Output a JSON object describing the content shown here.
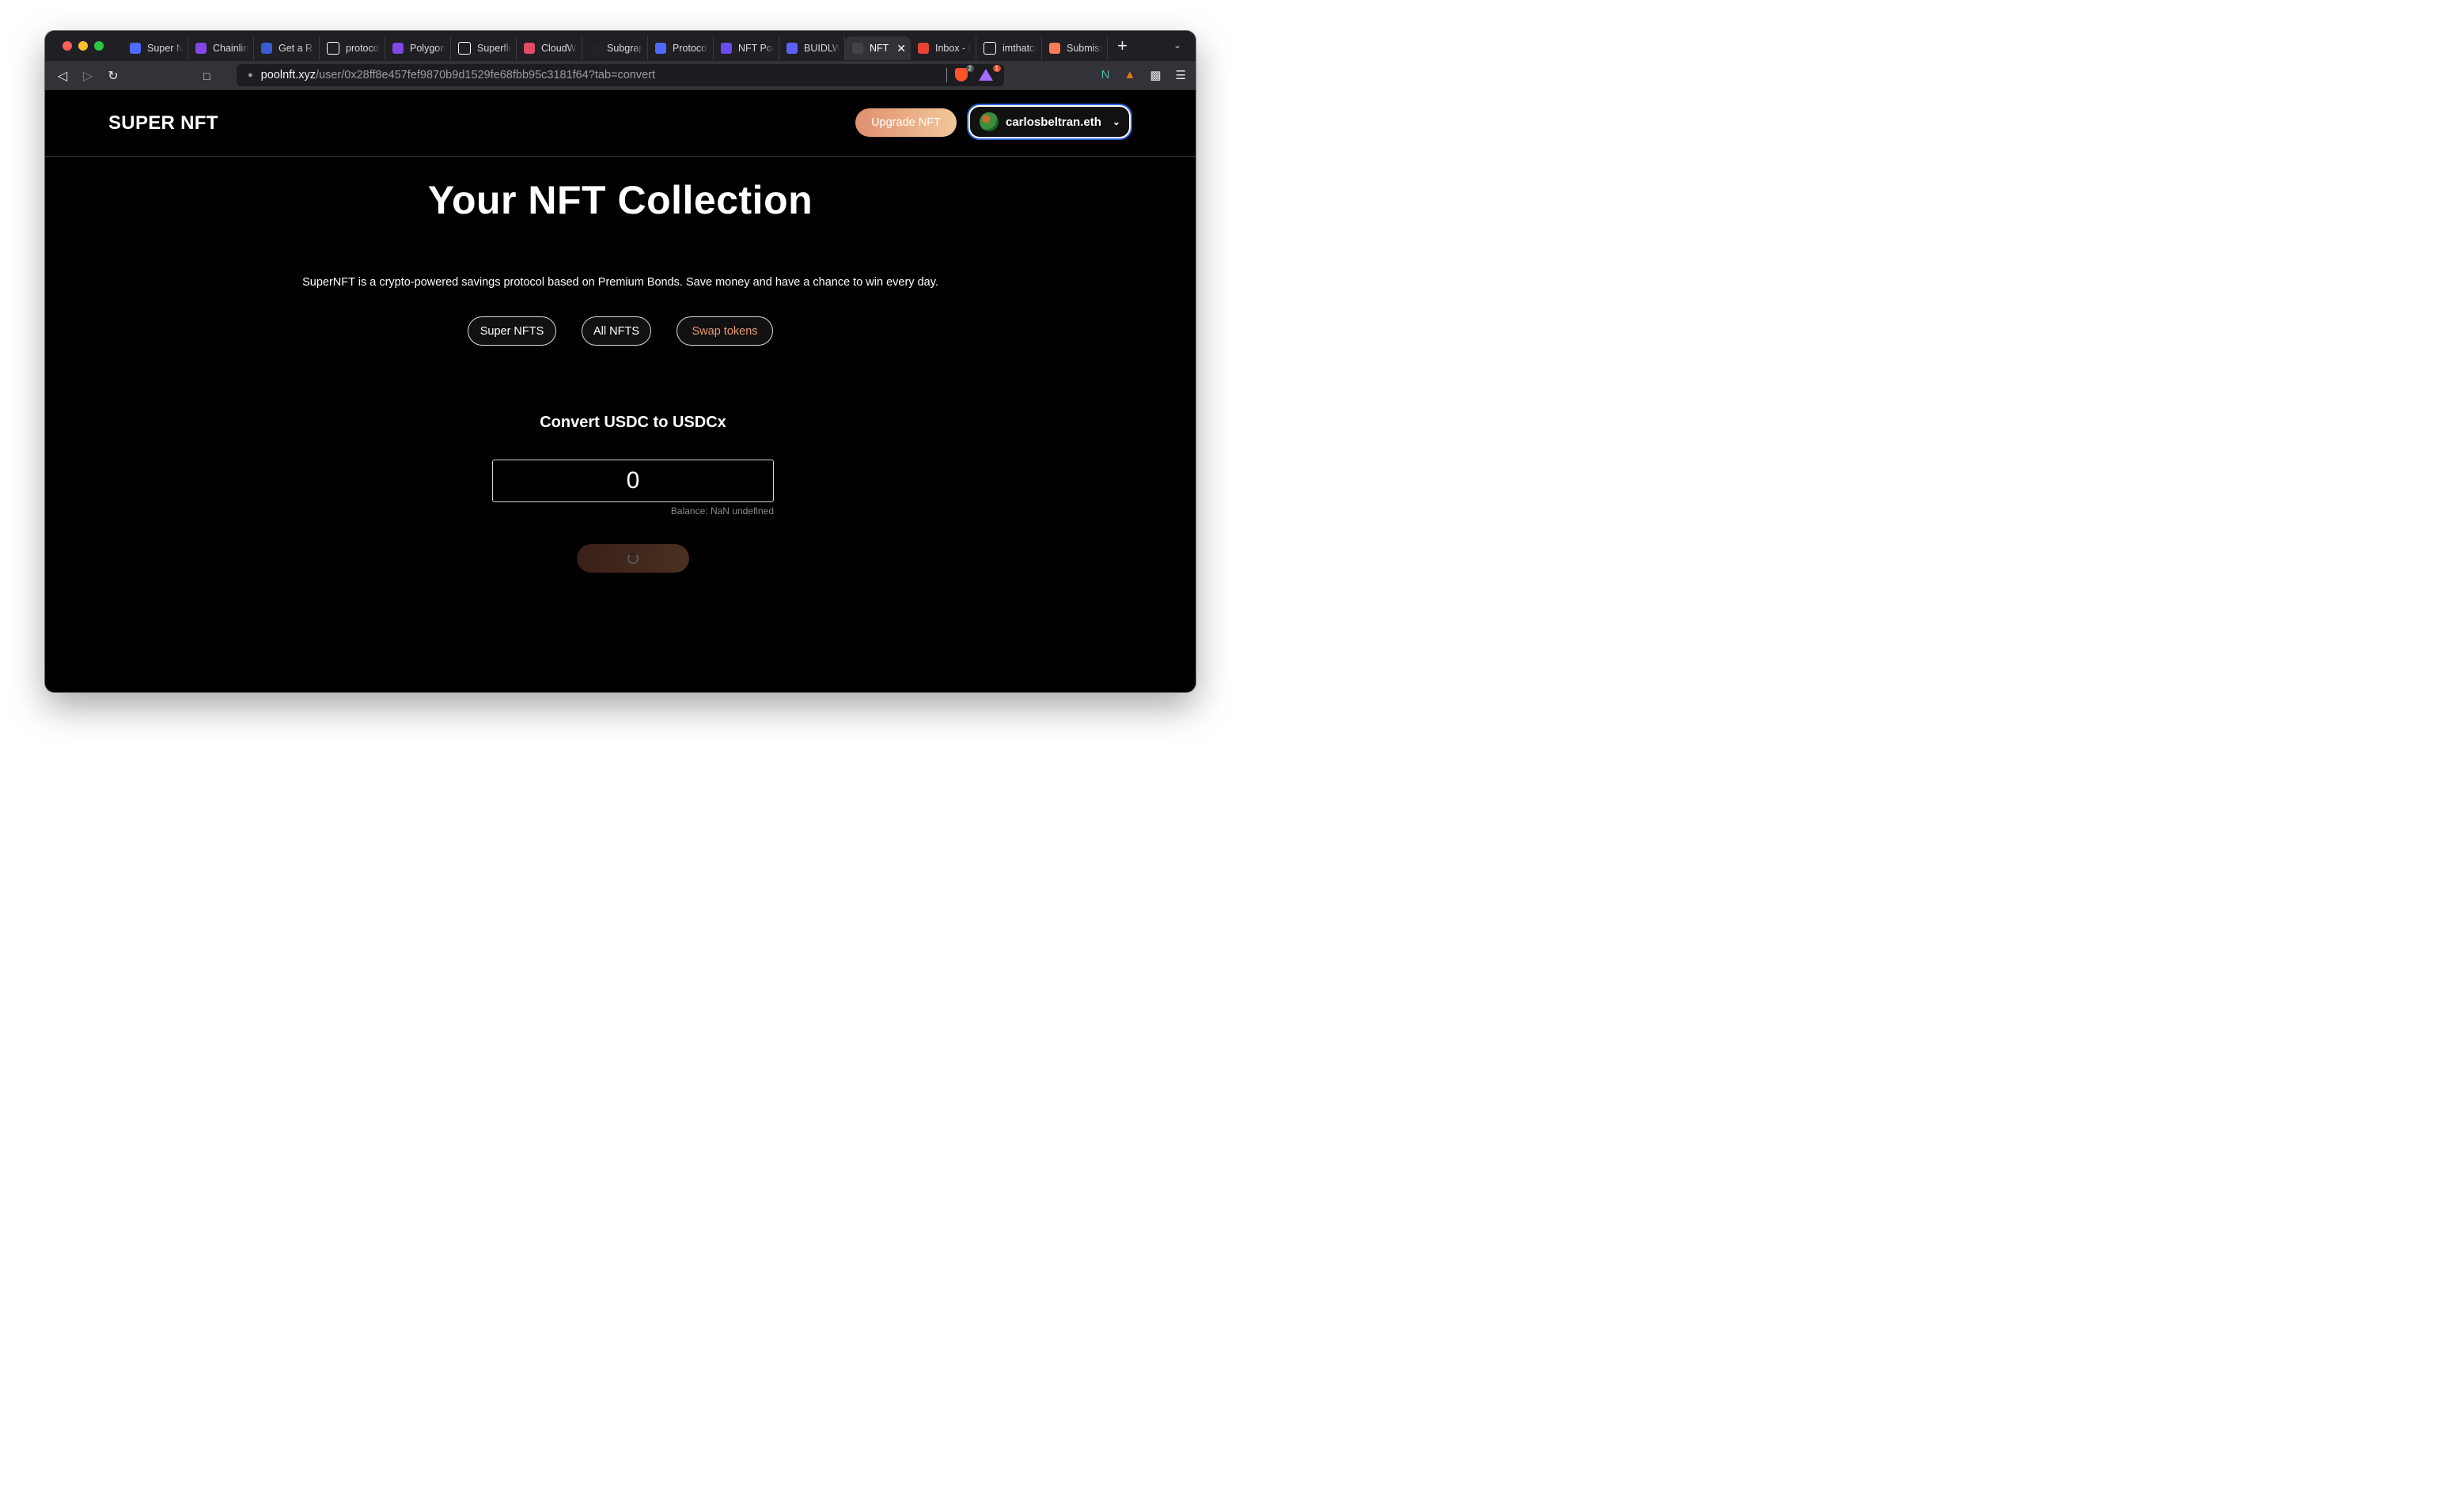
{
  "browser": {
    "tabs": [
      {
        "title": "Super N",
        "favicon": "superfluid-icon",
        "color": "#4f6bff"
      },
      {
        "title": "Chainlin",
        "favicon": "polygon-icon",
        "color": "#8247e5"
      },
      {
        "title": "Get a Ra",
        "favicon": "chainlink-icon",
        "color": "#375bd2"
      },
      {
        "title": "protocol",
        "favicon": "github-icon",
        "color": "#ffffff"
      },
      {
        "title": "Polygon",
        "favicon": "polygon-icon",
        "color": "#8247e5"
      },
      {
        "title": "Superflu",
        "favicon": "superfluid-icon",
        "color": "#ffffff"
      },
      {
        "title": "CloudW",
        "favicon": "cloudwalk-icon",
        "color": "#e04b6a"
      },
      {
        "title": "Subgrap",
        "favicon": "subgraph-icon",
        "color": "#222222"
      },
      {
        "title": "Protoco",
        "favicon": "superfluid-icon",
        "color": "#4f6bff"
      },
      {
        "title": "NFT Poo",
        "favicon": "nft-pool-icon",
        "color": "#6c4cf0"
      },
      {
        "title": "BUIDLW",
        "favicon": "buidl-icon",
        "color": "#5f5fff"
      },
      {
        "title": "NFT",
        "favicon": "sn-icon",
        "color": "#444444",
        "active": true
      },
      {
        "title": "Inbox - l",
        "favicon": "gmail-icon",
        "color": "#ea4335"
      },
      {
        "title": "imthatca",
        "favicon": "github-icon",
        "color": "#ffffff"
      },
      {
        "title": "Submiss",
        "favicon": "submission-icon",
        "color": "#ff7a59"
      }
    ],
    "url_host": "poolnft.xyz",
    "url_path": "/user/0x28ff8e457fef9870b9d1529fe68fbb95c3181f64?tab=convert",
    "badges": {
      "brave": "2",
      "alert": "1"
    }
  },
  "header": {
    "logo": "SUPER NFT",
    "upgrade_label": "Upgrade NFT",
    "account_name": "carlosbeltran.eth"
  },
  "main": {
    "title": "Your NFT Collection",
    "tagline": "SuperNFT is a crypto-powered savings protocol based on Premium Bonds. Save money and have a chance to win every day.",
    "filters": [
      "Super NFTS",
      "All NFTS",
      "Swap tokens"
    ],
    "convert_title": "Convert USDC to USDCx",
    "amount_value": "0",
    "balance_text": "Balance: NaN undefined"
  },
  "colors": {
    "accent": "#e79a72",
    "upgrade_gradient_start": "#e0906e",
    "upgrade_gradient_end": "#f2c79a",
    "account_ring": "#2d63d8"
  }
}
